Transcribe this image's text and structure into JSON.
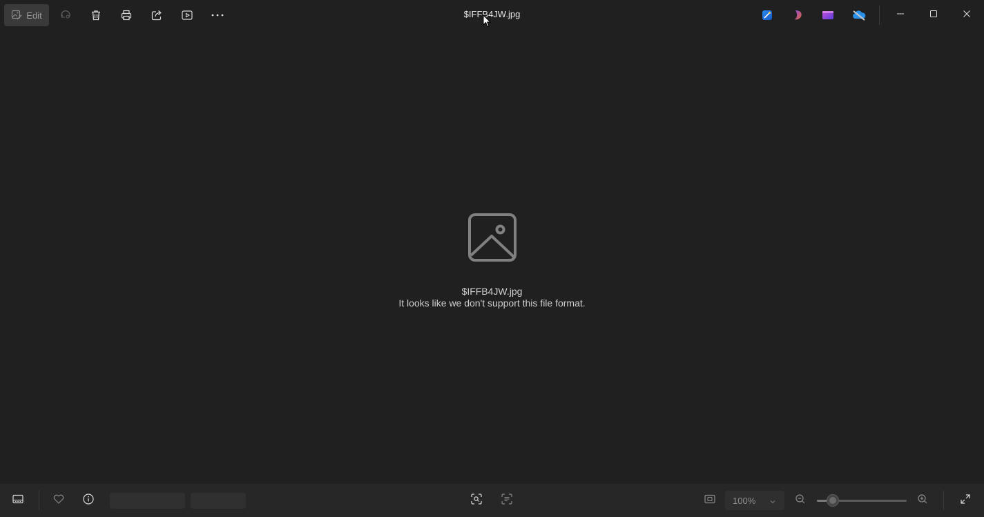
{
  "window": {
    "title": "$IFFB4JW.jpg"
  },
  "toolbar": {
    "edit_label": "Edit",
    "icons": [
      "edit-icon",
      "rotate-icon",
      "delete-icon",
      "print-icon",
      "share-icon",
      "slideshow-icon",
      "more-icon"
    ]
  },
  "taskbar_apps": [
    "designer-icon",
    "clipchamp-icon",
    "video-editor-icon",
    "onedrive-offline-icon"
  ],
  "content": {
    "file_name": "$IFFB4JW.jpg",
    "message": "It looks like we don't support this file format."
  },
  "statusbar": {
    "zoom_value": "100%",
    "zoom_level_fraction": 0.18
  },
  "colors": {
    "background": "#202020",
    "bottombar": "#272727",
    "text": "#cfcfcf",
    "muted": "#8f8f8f"
  }
}
